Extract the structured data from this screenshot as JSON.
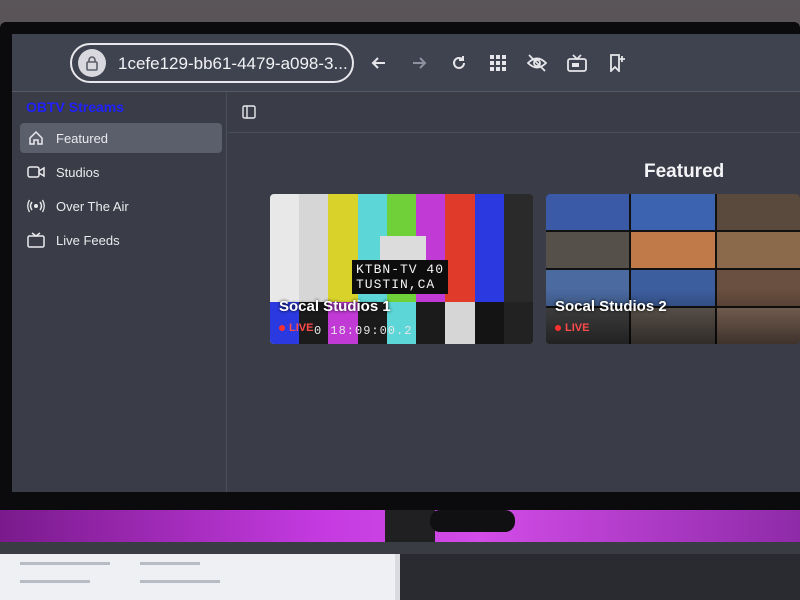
{
  "browser": {
    "url": "1cefe129-bb61-4479-a098-3...",
    "icons": [
      "lock-icon",
      "back-icon",
      "forward-icon",
      "reload-icon",
      "grid-icon",
      "eye-off-icon",
      "tv-icon",
      "bookmark-add-icon"
    ]
  },
  "sidebar": {
    "app_title": "OBTV Streams",
    "items": [
      {
        "label": "Featured",
        "icon": "home-icon",
        "active": true
      },
      {
        "label": "Studios",
        "icon": "video-icon",
        "active": false
      },
      {
        "label": "Over The Air",
        "icon": "broadcast-icon",
        "active": false
      },
      {
        "label": "Live Feeds",
        "icon": "tv-icon",
        "active": false
      }
    ]
  },
  "main": {
    "section_title": "Featured",
    "cards": [
      {
        "title": "Socal Studios 1",
        "live_label": "LIVE",
        "station_id_line1": "KTBN-TV 40",
        "station_id_line2": "TUSTIN,CA",
        "timecode": "0 18:09:00.2"
      },
      {
        "title": "Socal Studios 2",
        "live_label": "LIVE"
      }
    ]
  },
  "colors": {
    "accent_title": "#2020ff",
    "live_red": "#ff4a4a",
    "bars": [
      "#e8e8e8",
      "#d8d8d8",
      "#d8d22a",
      "#5cd6d6",
      "#6fd03a",
      "#c13ad6",
      "#e03a2a",
      "#2a3ae0",
      "#2a2a2a"
    ]
  }
}
